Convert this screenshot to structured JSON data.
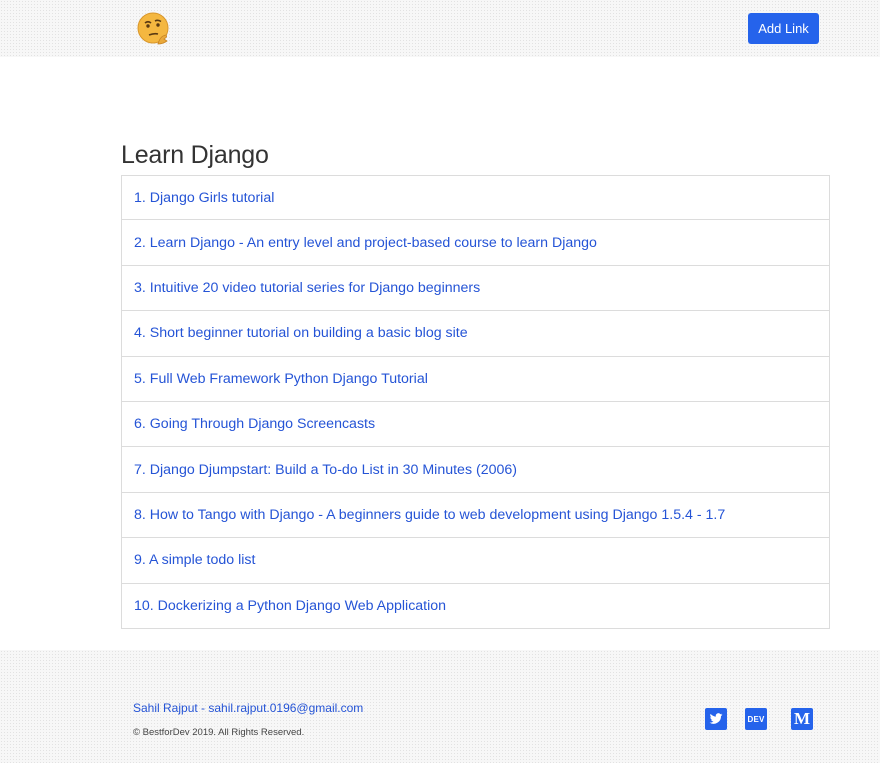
{
  "header": {
    "logo_icon": "thinking-face-icon",
    "add_link_label": "Add Link"
  },
  "main": {
    "title": "Learn Django",
    "links": [
      "1. Django Girls tutorial",
      "2. Learn Django - An entry level and project-based course to learn Django",
      "3. Intuitive 20 video tutorial series for Django beginners",
      "4. Short beginner tutorial on building a basic blog site",
      "5. Full Web Framework Python Django Tutorial",
      "6. Going Through Django Screencasts",
      "7. Django Djumpstart: Build a To-do List in 30 Minutes (2006)",
      "8. How to Tango with Django - A beginners guide to web development using Django 1.5.4 - 1.7",
      "9. A simple todo list",
      "10. Dockerizing a Python Django Web Application"
    ]
  },
  "footer": {
    "contact": "Sahil Rajput - sahil.rajput.0196@gmail.com",
    "copyright": "© BestforDev 2019. All Rights Reserved.",
    "social_icons": [
      "twitter-icon",
      "dev-icon",
      "medium-icon"
    ],
    "dev_label": "DEV",
    "medium_label": "M"
  },
  "colors": {
    "accent": "#2563eb",
    "link": "#2554d6"
  }
}
